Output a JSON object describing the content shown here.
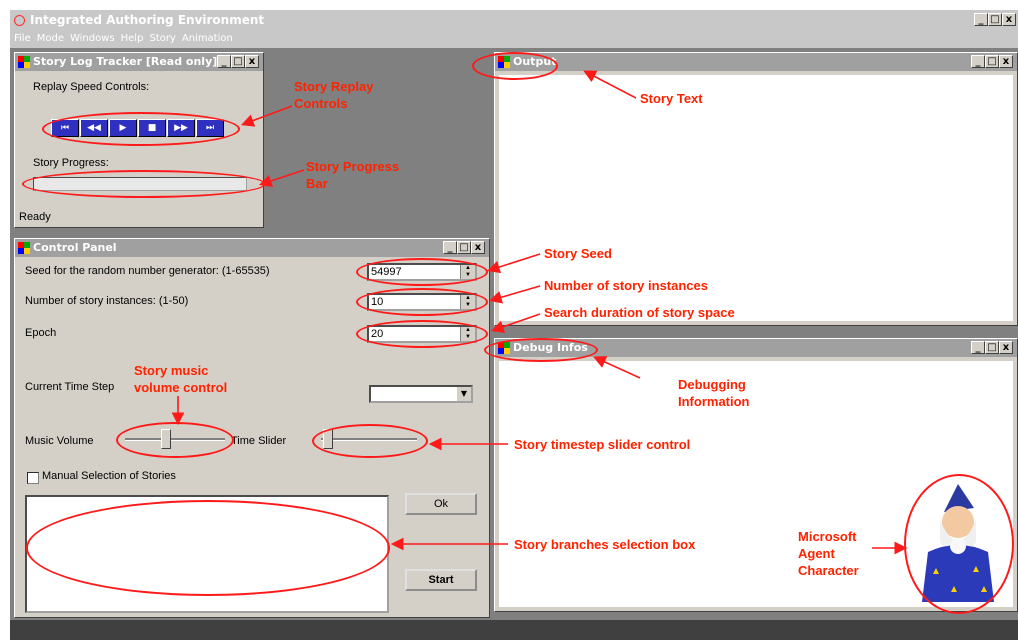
{
  "app": {
    "title": "Integrated Authoring Environment",
    "menu": [
      "File",
      "Mode",
      "Windows",
      "Help",
      "Story",
      "Animation"
    ],
    "window_controls": [
      "_",
      "□",
      "x"
    ]
  },
  "log_tracker": {
    "title": "Story Log Tracker [Read only]",
    "replay_label": "Replay Speed Controls:",
    "buttons": [
      "⏮",
      "◀◀",
      "▶",
      "■",
      "▶▶",
      "⏭"
    ],
    "progress_label": "Story Progress:",
    "status": "Ready"
  },
  "control_panel": {
    "title": "Control Panel",
    "seed_label": "Seed for the random number generator: (1-65535)",
    "seed_value": "54997",
    "instances_label": "Number of story instances: (1-50)",
    "instances_value": "10",
    "epoch_label": "Epoch",
    "epoch_value": "20",
    "timestep_label": "Current Time Step",
    "music_label": "Music Volume",
    "timeslider_label": "Time Slider",
    "manual_label": "Manual Selection of Stories",
    "ok_label": "Ok",
    "start_label": "Start"
  },
  "output": {
    "title": "Output"
  },
  "debug": {
    "title": "Debug Infos"
  },
  "annotations": {
    "replay": "Story Replay Controls",
    "progress": "Story Progress Bar",
    "story_text": "Story Text",
    "seed": "Story Seed",
    "instances": "Number of story instances",
    "search": "Search duration of story space",
    "music": "Story music volume control",
    "debug": "Debugging Information",
    "timestep": "Story timestep slider control",
    "branches": "Story branches selection box",
    "agent": "Microsoft Agent Character"
  },
  "colors": {
    "annotation": "#ff2200",
    "title_inactive": "#a0a0a0",
    "button_blue": "#3030c0"
  }
}
